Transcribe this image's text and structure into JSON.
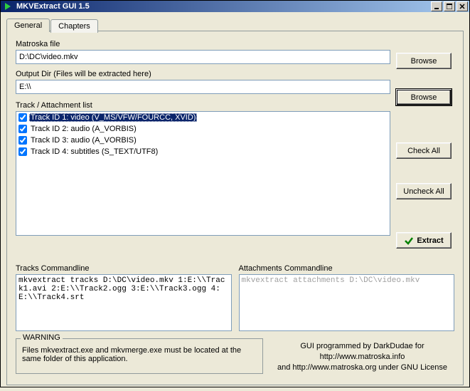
{
  "window": {
    "title": "MKVExtract GUI 1.5"
  },
  "tabs": {
    "general": "General",
    "chapters": "Chapters"
  },
  "labels": {
    "matroska_file": "Matroska file",
    "output_dir": "Output Dir (Files will be extracted here)",
    "track_list": "Track / Attachment list",
    "tracks_cmd": "Tracks Commandline",
    "attachments_cmd": "Attachments Commandline"
  },
  "inputs": {
    "matroska_file": "D:\\DC\\video.mkv",
    "output_dir": "E:\\\\"
  },
  "buttons": {
    "browse": "Browse",
    "check_all": "Check All",
    "uncheck_all": "Uncheck All",
    "extract": "Extract"
  },
  "tracks": [
    "Track ID 1: video (V_MS/VFW/FOURCC, XVID)",
    "Track ID 2: audio (A_VORBIS)",
    "Track ID 3: audio (A_VORBIS)",
    "Track ID 4: subtitles (S_TEXT/UTF8)"
  ],
  "cmdlines": {
    "tracks": "mkvextract tracks D:\\DC\\video.mkv 1:E:\\\\Track1.avi 2:E:\\\\Track2.ogg 3:E:\\\\Track3.ogg 4:E:\\\\Track4.srt",
    "attachments": "mkvextract attachments D:\\DC\\video.mkv"
  },
  "warning": {
    "legend": "WARNING",
    "text": "Files mkvextract.exe and mkvmerge.exe must be located at the same folder of this application."
  },
  "credits": {
    "line1": "GUI programmed by DarkDudae for http://www.matroska.info",
    "line2": "and http://www.matroska.org under GNU License"
  }
}
